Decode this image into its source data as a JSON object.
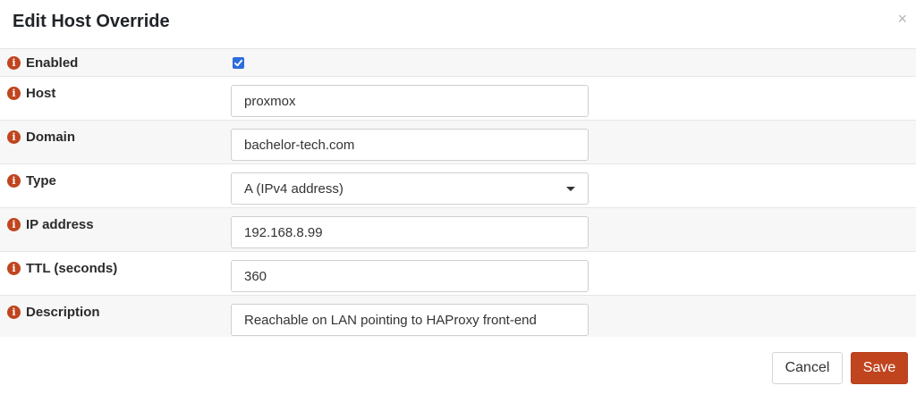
{
  "dialog": {
    "title": "Edit Host Override",
    "close_glyph": "×"
  },
  "fields": {
    "enabled": {
      "label": "Enabled",
      "checked": true
    },
    "host": {
      "label": "Host",
      "value": "proxmox"
    },
    "domain": {
      "label": "Domain",
      "value": "bachelor-tech.com"
    },
    "type": {
      "label": "Type",
      "value": "A (IPv4 address)"
    },
    "ip_address": {
      "label": "IP address",
      "value": "192.168.8.99"
    },
    "ttl": {
      "label": "TTL (seconds)",
      "value": "360"
    },
    "description": {
      "label": "Description",
      "value": "Reachable on LAN pointing to HAProxy front-end"
    }
  },
  "info_glyph": "i",
  "buttons": {
    "cancel": "Cancel",
    "save": "Save"
  },
  "colors": {
    "accent": "#c0451f",
    "checkbox": "#2d6ddb",
    "row_alt": "#f7f7f7"
  },
  "icons": {
    "info": "info-icon",
    "close": "close-icon",
    "dropdown": "caret-down-icon",
    "check": "check-icon"
  }
}
